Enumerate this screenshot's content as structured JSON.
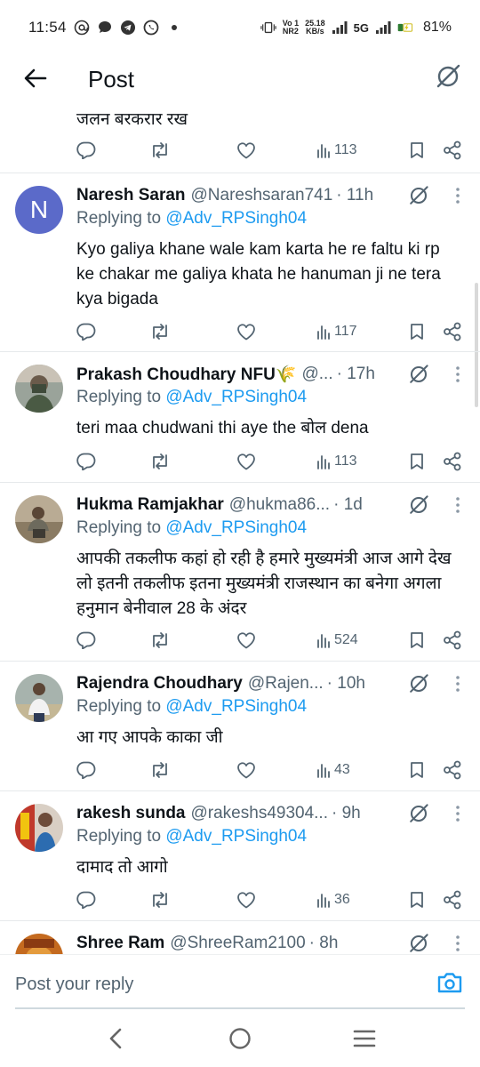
{
  "status_bar": {
    "time": "11:54",
    "net_label_top": "Vo 1",
    "net_label_bottom": "NR2",
    "speed_top": "25.18",
    "speed_bottom": "KB/s",
    "network_type": "5G",
    "battery": "81%"
  },
  "header": {
    "title": "Post"
  },
  "partial_top": {
    "text": "जलन बरकरार रख",
    "views": "113"
  },
  "replies": [
    {
      "avatar_letter": "N",
      "name": "Naresh Saran",
      "handle": "@Nareshsaran741",
      "time": "· 11h",
      "replying_prefix": "Replying to",
      "replying_to": "@Adv_RPSingh04",
      "text": "Kyo galiya khane wale kam karta he re faltu ki rp ke chakar me galiya khata he hanuman ji ne tera kya bigada",
      "views": "117"
    },
    {
      "avatar_letter": "",
      "name": "Prakash Choudhary NFU🌾",
      "handle": "@...",
      "time": "· 17h",
      "replying_prefix": "Replying to",
      "replying_to": "@Adv_RPSingh04",
      "text": "teri maa chudwani thi aye the बोल dena",
      "views": "113"
    },
    {
      "avatar_letter": "",
      "name": "Hukma Ramjakhar",
      "handle": "@hukma86...",
      "time": "· 1d",
      "replying_prefix": "Replying to",
      "replying_to": "@Adv_RPSingh04",
      "text": "आपकी तकलीफ कहां हो रही है हमारे मुख्यमंत्री आज आगे देख लो इतनी तकलीफ इतना मुख्यमंत्री राजस्थान का बनेगा अगला हनुमान बेनीवाल 28 के अंदर",
      "views": "524"
    },
    {
      "avatar_letter": "",
      "name": "Rajendra Choudhary",
      "handle": "@Rajen...",
      "time": "· 10h",
      "replying_prefix": "Replying to",
      "replying_to": "@Adv_RPSingh04",
      "text": "आ गए आपके काका जी",
      "views": "43"
    },
    {
      "avatar_letter": "",
      "name": "rakesh sunda",
      "handle": "@rakeshs49304...",
      "time": "· 9h",
      "replying_prefix": "Replying to",
      "replying_to": "@Adv_RPSingh04",
      "text": "दामाद तो आगो",
      "views": "36"
    },
    {
      "avatar_letter": "",
      "name": "Shree Ram",
      "handle": "@ShreeRam2100",
      "time": "· 8h",
      "replying_prefix": "",
      "replying_to": "",
      "text": "",
      "views": ""
    }
  ],
  "composer": {
    "placeholder": "Post your reply"
  },
  "icons": {
    "back": "arrow-left-icon",
    "grok": "grok-icon",
    "reply": "comment-icon",
    "repost": "repost-icon",
    "like": "heart-icon",
    "views": "views-chart-icon",
    "bookmark": "bookmark-icon",
    "share": "share-icon",
    "more": "more-vertical-icon",
    "camera": "camera-icon"
  },
  "colors": {
    "accent": "#1d9bf0",
    "text_primary": "#0f1419",
    "text_secondary": "#536471",
    "avatar_n": "#5b6ac9"
  }
}
